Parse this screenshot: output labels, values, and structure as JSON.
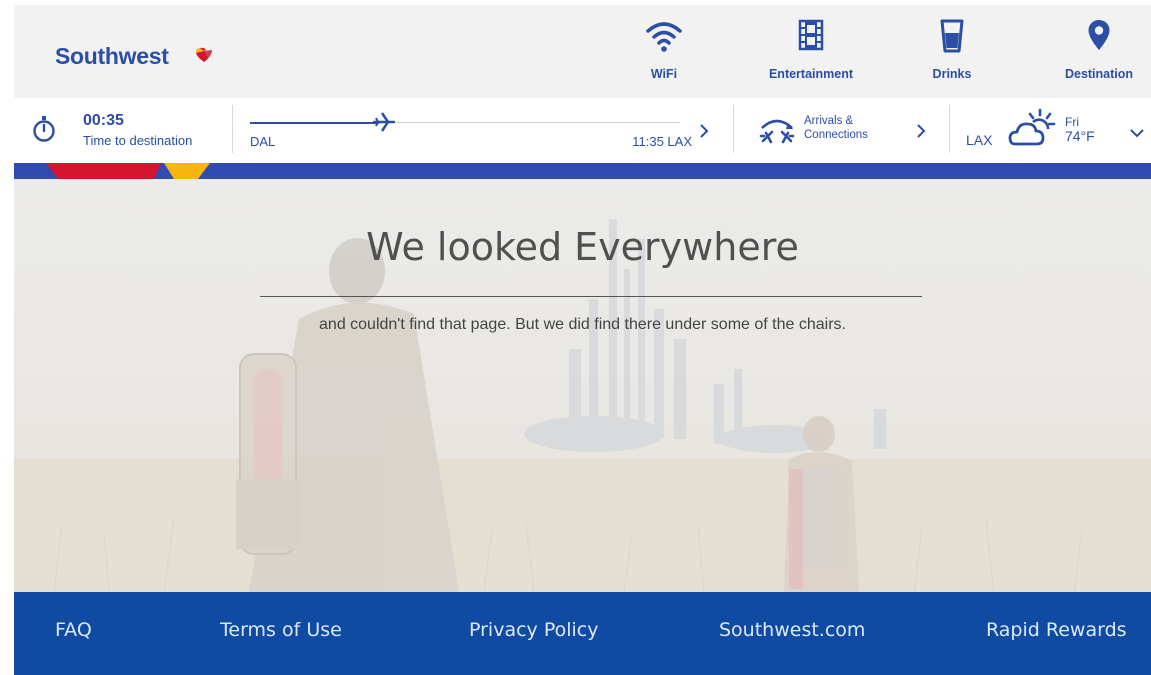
{
  "brand": {
    "name": "Southwest",
    "navy": "#2b4fa4",
    "red": "#d5152e",
    "yellow": "#f9b612",
    "blue": "#304cb2"
  },
  "nav": {
    "items": [
      {
        "label": "WiFi",
        "icon": "wifi-icon"
      },
      {
        "label": "Entertainment",
        "icon": "film-icon"
      },
      {
        "label": "Drinks",
        "icon": "cup-icon"
      },
      {
        "label": "Destination",
        "icon": "location-pin-icon"
      }
    ]
  },
  "flight": {
    "time_remaining": "00:35",
    "time_label": "Time to destination",
    "origin": "DAL",
    "arrival": "11:35 LAX",
    "progress": 0.3
  },
  "arrivals": {
    "label": "Arrivals &\nConnections",
    "icon": "arrivals-connections-icon"
  },
  "weather": {
    "city": "LAX",
    "day": "Fri",
    "temp": "74°F",
    "icon": "partly-cloudy-icon"
  },
  "hero": {
    "headline": "We looked Everywhere",
    "subline": "and couldn't find that page. But we did find there under some of the chairs."
  },
  "footer": {
    "links": [
      "FAQ",
      "Terms of Use",
      "Privacy Policy",
      "Southwest.com",
      "Rapid Rewards"
    ],
    "background": "#0f4aa3"
  }
}
